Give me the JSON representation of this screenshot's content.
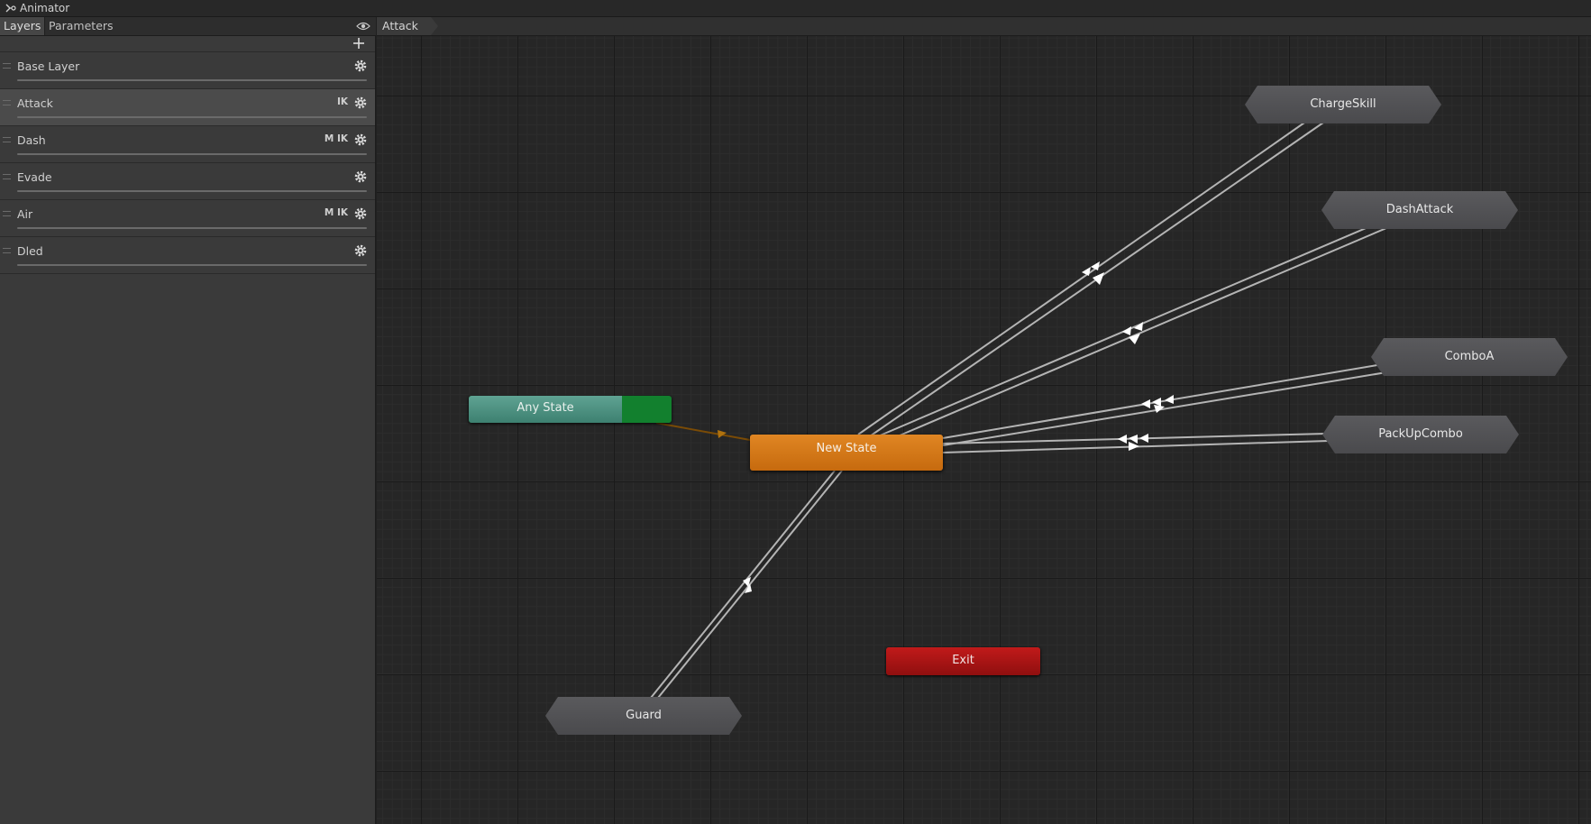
{
  "window": {
    "title": "Animator",
    "icon": "animator-icon"
  },
  "left_panel": {
    "tabs": [
      {
        "label": "Layers",
        "active": true
      },
      {
        "label": "Parameters",
        "active": false
      }
    ],
    "visibility_icon": "eye-icon",
    "add_icon": "plus-icon",
    "layers": [
      {
        "name": "Base Layer",
        "flags": "",
        "selected": false
      },
      {
        "name": "Attack",
        "flags": "IK",
        "selected": true
      },
      {
        "name": "Dash",
        "flags": "M IK",
        "selected": false
      },
      {
        "name": "Evade",
        "flags": "",
        "selected": false
      },
      {
        "name": "Air",
        "flags": "M IK",
        "selected": false
      },
      {
        "name": "Dled",
        "flags": "",
        "selected": false
      }
    ]
  },
  "graph": {
    "breadcrumb": "Attack",
    "states": {
      "any_state": "Any State",
      "new_state": "New State",
      "exit": "Exit",
      "charge_skill": "ChargeSkill",
      "dash_attack": "DashAttack",
      "combo_a": "ComboA",
      "pack_up_combo": "PackUpCombo",
      "guard": "Guard"
    },
    "colors": {
      "any_state": "#4f9383",
      "new_state": "#d7791a",
      "exit": "#a91414",
      "state": "#505053",
      "transition": "#b4b4b4",
      "default_transition": "#7a4b06"
    }
  }
}
